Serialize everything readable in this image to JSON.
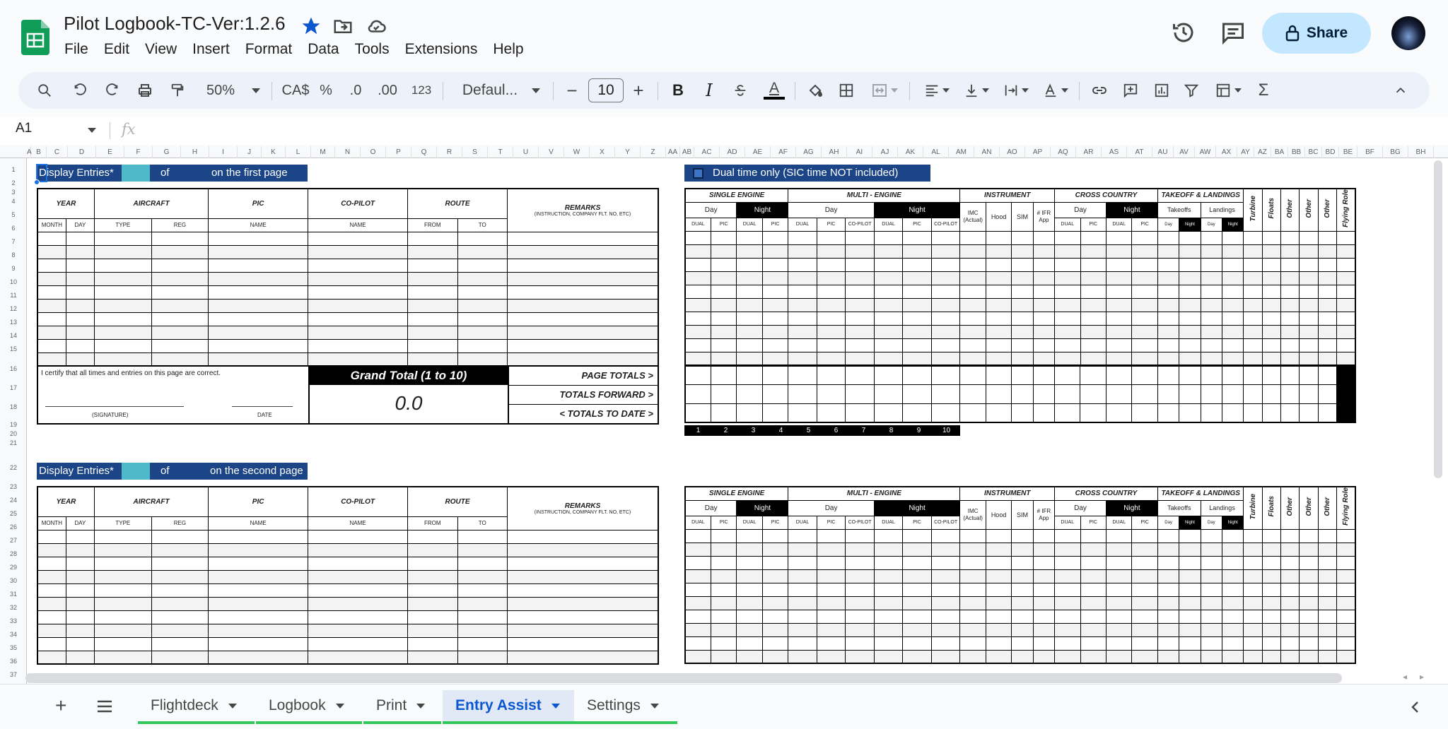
{
  "app": {
    "title": "Pilot Logbook-TC-Ver:1.2.6",
    "menu": [
      "File",
      "Edit",
      "View",
      "Insert",
      "Format",
      "Data",
      "Tools",
      "Extensions",
      "Help"
    ],
    "share_label": "Share"
  },
  "toolbar": {
    "zoom": "50%",
    "currency": "CA$",
    "percent": "%",
    "dec_decrease": ".0",
    "dec_increase": ".00",
    "number_format": "123",
    "font": "Defaul...",
    "font_size": "10",
    "bold": "B",
    "italic": "I",
    "text_color": "A"
  },
  "formula_bar": {
    "cell": "A1",
    "fx": "fx"
  },
  "columns": [
    "A",
    "B",
    "C",
    "D",
    "E",
    "F",
    "G",
    "H",
    "I",
    "J",
    "K",
    "L",
    "M",
    "N",
    "O",
    "P",
    "Q",
    "R",
    "S",
    "T",
    "U",
    "V",
    "W",
    "X",
    "Y",
    "Z",
    "AA",
    "AB",
    "AC",
    "AD",
    "AE",
    "AF",
    "AG",
    "AH",
    "AI",
    "AJ",
    "AK",
    "AL",
    "AM",
    "AN",
    "AO",
    "AP",
    "AQ",
    "AR",
    "AS",
    "AT",
    "AU",
    "AV",
    "AW",
    "AX",
    "AY",
    "AZ",
    "BA",
    "BB",
    "BC",
    "BD",
    "BE",
    "BF",
    "BG",
    "BH"
  ],
  "rows": [
    "1",
    "2",
    "3",
    "4",
    "5",
    "6",
    "7",
    "8",
    "9",
    "10",
    "11",
    "12",
    "13",
    "14",
    "15",
    "16",
    "17",
    "18",
    "19",
    "20",
    "21",
    "22",
    "23",
    "24",
    "25",
    "26",
    "27",
    "28",
    "29",
    "30",
    "31",
    "32",
    "33",
    "34",
    "35",
    "36",
    "37"
  ],
  "page1": {
    "band_display": "Display Entries*",
    "band_of": "of",
    "band_tail": "on the first page and",
    "dual_note": "Dual time only (SIC time NOT included)",
    "certify": "I certify that all times and entries on this page are correct.",
    "signature": "(SIGNATURE)",
    "date": "DATE",
    "grand_total_label": "Grand Total (1 to 10)",
    "grand_total_value": "0.0",
    "page_totals": "PAGE TOTALS  >",
    "totals_forward": "TOTALS FORWARD  >",
    "totals_to_date": "<  TOTALS TO DATE  >",
    "col_numbers": [
      "1",
      "2",
      "3",
      "4",
      "5",
      "6",
      "7",
      "8",
      "9",
      "10"
    ]
  },
  "page2": {
    "band_display": "Display Entries*",
    "band_of": "of",
    "band_tail": "on the second page"
  },
  "left_table": {
    "year": "YEAR",
    "aircraft": "AIRCRAFT",
    "pic": "PIC",
    "copilot": "CO-PILOT",
    "route": "ROUTE",
    "remarks": "REMARKS",
    "remarks_sub": "(INSTRUCTION, COMPANY FLT. NO, ETC)",
    "month": "MONTH",
    "day": "DAY",
    "type": "TYPE",
    "reg": "REG",
    "name": "NAME",
    "name2": "NAME",
    "from": "FROM",
    "to": "TO"
  },
  "right_table": {
    "single_engine": "SINGLE ENGINE",
    "multi_engine": "MULTI - ENGINE",
    "instrument": "INSTRUMENT",
    "cross_country": "CROSS COUNTRY",
    "takeoff_landings": "TAKEOFF & LANDINGS",
    "day": "Day",
    "night": "Night",
    "imc": "IMC (Actual)",
    "hood": "Hood",
    "sim": "SIM",
    "ifr": "# IFR App",
    "takeoffs": "Takeoffs",
    "landings": "Landings",
    "turbine": "Turbine",
    "floats": "Floats",
    "other1": "Other",
    "other2": "Other",
    "other3": "Other",
    "flying_role": "Flying Role",
    "dual": "DUAL",
    "pic": "PIC",
    "copilot": "CO-PILOT",
    "sday": "Day",
    "snight": "Night"
  },
  "tabs": [
    "Flightdeck",
    "Logbook",
    "Print",
    "Entry Assist",
    "Settings"
  ],
  "active_tab": "Entry Assist"
}
